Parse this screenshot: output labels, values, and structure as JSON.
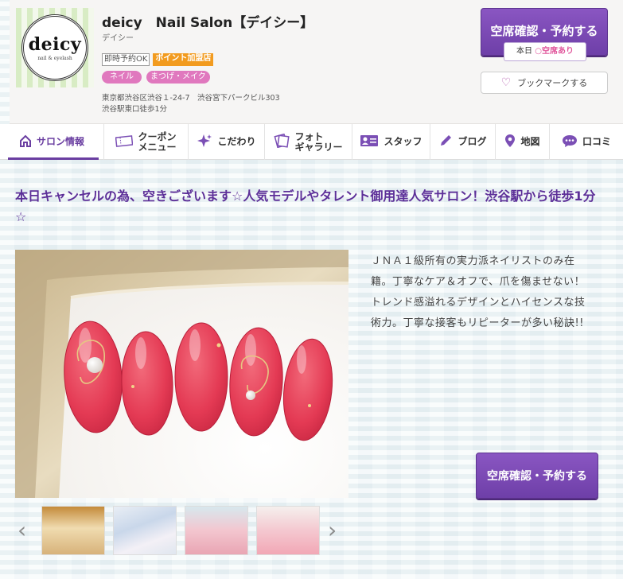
{
  "salon": {
    "name": "deicy　Nail Salon【デイシー】",
    "kana": "デイシー",
    "logo_text": "deicy",
    "logo_sub": "nail & eyelash",
    "tags": [
      "即時予約OK",
      "ポイント加盟店"
    ],
    "categories": [
      "ネイル",
      "まつげ・メイク"
    ],
    "address": "東京都渋谷区渋谷１-24-7　渋谷宮下パークビル303",
    "access": "渋谷駅東口徒歩1分"
  },
  "reserve_top": {
    "label": "空席確認・予約する",
    "today": "本日",
    "availability": "○空席あり"
  },
  "bookmark": {
    "label": "ブックマークする"
  },
  "nav": {
    "salon_info": "サロン情報",
    "coupon_line1": "クーポン",
    "coupon_line2": "メニュー",
    "kodawari": "こだわり",
    "photo_line1": "フォト",
    "photo_line2": "ギャラリー",
    "staff": "スタッフ",
    "blog": "ブログ",
    "map": "地図",
    "review": "口コミ"
  },
  "main": {
    "catchcopy": "本日キャンセルの為、空きございます☆人気モデルやタレント御用達人気サロン！渋谷駅から徒歩1分☆",
    "description": "ＪＮＡ１級所有の実力派ネイリストのみ在籍。丁寧なケア＆オフで、爪を傷ませない！トレンド感溢れるデザインとハイセンスな技術力。丁寧な接客もリピーターが多い秘訣!!",
    "reserve_label": "空席確認・予約する"
  },
  "gallery": {
    "prev": "‹",
    "next": "›"
  }
}
